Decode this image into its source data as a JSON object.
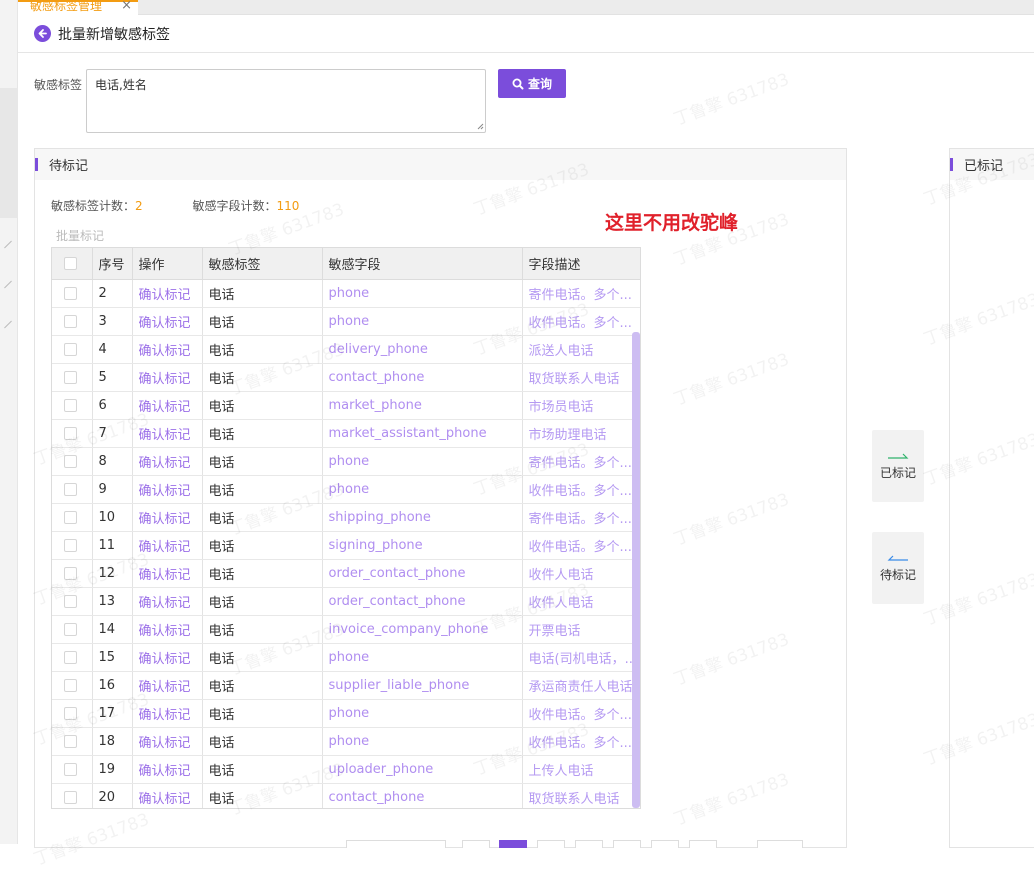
{
  "tab": {
    "label": "敏感标签管理",
    "close": "×"
  },
  "page": {
    "title": "批量新增敏感标签"
  },
  "filter": {
    "label": "敏感标签",
    "value": "电话,姓名",
    "query_label": "查询"
  },
  "pending_panel": {
    "title": "待标记",
    "tag_count_label": "敏感标签计数：",
    "tag_count": "2",
    "field_count_label": "敏感字段计数：",
    "field_count": "110",
    "batch_label": "批量标记"
  },
  "annotation": "这里不用改驼峰",
  "table": {
    "headers": [
      "序号",
      "操作",
      "敏感标签",
      "敏感字段",
      "字段描述"
    ],
    "rows": [
      {
        "no": "2",
        "action": "确认标记",
        "tag": "电话",
        "field": "phone",
        "desc": "寄件电话。多个..."
      },
      {
        "no": "3",
        "action": "确认标记",
        "tag": "电话",
        "field": "phone",
        "desc": "收件电话。多个..."
      },
      {
        "no": "4",
        "action": "确认标记",
        "tag": "电话",
        "field": "delivery_phone",
        "desc": "派送人电话"
      },
      {
        "no": "5",
        "action": "确认标记",
        "tag": "电话",
        "field": "contact_phone",
        "desc": "取货联系人电话"
      },
      {
        "no": "6",
        "action": "确认标记",
        "tag": "电话",
        "field": "market_phone",
        "desc": "市场员电话"
      },
      {
        "no": "7",
        "action": "确认标记",
        "tag": "电话",
        "field": "market_assistant_phone",
        "desc": "市场助理电话"
      },
      {
        "no": "8",
        "action": "确认标记",
        "tag": "电话",
        "field": "phone",
        "desc": "寄件电话。多个..."
      },
      {
        "no": "9",
        "action": "确认标记",
        "tag": "电话",
        "field": "phone",
        "desc": "收件电话。多个..."
      },
      {
        "no": "10",
        "action": "确认标记",
        "tag": "电话",
        "field": "shipping_phone",
        "desc": "寄件电话。多个..."
      },
      {
        "no": "11",
        "action": "确认标记",
        "tag": "电话",
        "field": "signing_phone",
        "desc": "收件电话。多个..."
      },
      {
        "no": "12",
        "action": "确认标记",
        "tag": "电话",
        "field": "order_contact_phone",
        "desc": "收件人电话"
      },
      {
        "no": "13",
        "action": "确认标记",
        "tag": "电话",
        "field": "order_contact_phone",
        "desc": "收件人电话"
      },
      {
        "no": "14",
        "action": "确认标记",
        "tag": "电话",
        "field": "invoice_company_phone",
        "desc": "开票电话"
      },
      {
        "no": "15",
        "action": "确认标记",
        "tag": "电话",
        "field": "phone",
        "desc": "电话(司机电话，..."
      },
      {
        "no": "16",
        "action": "确认标记",
        "tag": "电话",
        "field": "supplier_liable_phone",
        "desc": "承运商责任人电话"
      },
      {
        "no": "17",
        "action": "确认标记",
        "tag": "电话",
        "field": "phone",
        "desc": "收件电话。多个..."
      },
      {
        "no": "18",
        "action": "确认标记",
        "tag": "电话",
        "field": "phone",
        "desc": "收件电话。多个..."
      },
      {
        "no": "19",
        "action": "确认标记",
        "tag": "电话",
        "field": "uploader_phone",
        "desc": "上传人电话"
      },
      {
        "no": "20",
        "action": "确认标记",
        "tag": "电话",
        "field": "contact_phone",
        "desc": "取货联系人电话"
      }
    ]
  },
  "transfer": {
    "to_marked": "已标记",
    "to_pending": "待标记"
  },
  "marked_panel": {
    "title": "已标记"
  },
  "watermark": "丁鲁擎 631783",
  "colors": {
    "accent": "#7b4ddb",
    "tab": "#f39c12",
    "annotation": "#e0212b",
    "count": "#f39c12"
  }
}
